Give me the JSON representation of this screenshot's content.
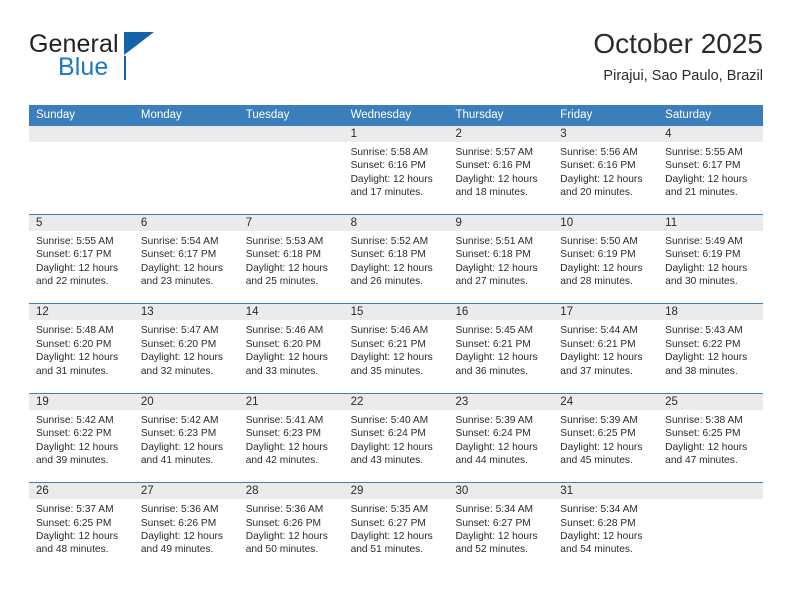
{
  "brand": {
    "name_part1": "General",
    "name_part2": "Blue",
    "logo_icon": "triangle-logo-icon",
    "accent_color": "#1463a8"
  },
  "header": {
    "title": "October 2025",
    "location": "Pirajui, Sao Paulo, Brazil"
  },
  "theme": {
    "header_blue": "#3b7ebc",
    "day_band_gray": "#ebebeb",
    "text": "#2b2b2b"
  },
  "calendar": {
    "weekdays": [
      "Sunday",
      "Monday",
      "Tuesday",
      "Wednesday",
      "Thursday",
      "Friday",
      "Saturday"
    ],
    "labels": {
      "sunrise_prefix": "Sunrise:",
      "sunset_prefix": "Sunset:",
      "daylight_prefix": "Daylight:"
    },
    "weeks": [
      [
        {
          "day": "",
          "empty": true
        },
        {
          "day": "",
          "empty": true
        },
        {
          "day": "",
          "empty": true
        },
        {
          "day": "1",
          "sunrise": "Sunrise: 5:58 AM",
          "sunset": "Sunset: 6:16 PM",
          "daylight_line1": "Daylight: 12 hours",
          "daylight_line2": "and 17 minutes."
        },
        {
          "day": "2",
          "sunrise": "Sunrise: 5:57 AM",
          "sunset": "Sunset: 6:16 PM",
          "daylight_line1": "Daylight: 12 hours",
          "daylight_line2": "and 18 minutes."
        },
        {
          "day": "3",
          "sunrise": "Sunrise: 5:56 AM",
          "sunset": "Sunset: 6:16 PM",
          "daylight_line1": "Daylight: 12 hours",
          "daylight_line2": "and 20 minutes."
        },
        {
          "day": "4",
          "sunrise": "Sunrise: 5:55 AM",
          "sunset": "Sunset: 6:17 PM",
          "daylight_line1": "Daylight: 12 hours",
          "daylight_line2": "and 21 minutes."
        }
      ],
      [
        {
          "day": "5",
          "sunrise": "Sunrise: 5:55 AM",
          "sunset": "Sunset: 6:17 PM",
          "daylight_line1": "Daylight: 12 hours",
          "daylight_line2": "and 22 minutes."
        },
        {
          "day": "6",
          "sunrise": "Sunrise: 5:54 AM",
          "sunset": "Sunset: 6:17 PM",
          "daylight_line1": "Daylight: 12 hours",
          "daylight_line2": "and 23 minutes."
        },
        {
          "day": "7",
          "sunrise": "Sunrise: 5:53 AM",
          "sunset": "Sunset: 6:18 PM",
          "daylight_line1": "Daylight: 12 hours",
          "daylight_line2": "and 25 minutes."
        },
        {
          "day": "8",
          "sunrise": "Sunrise: 5:52 AM",
          "sunset": "Sunset: 6:18 PM",
          "daylight_line1": "Daylight: 12 hours",
          "daylight_line2": "and 26 minutes."
        },
        {
          "day": "9",
          "sunrise": "Sunrise: 5:51 AM",
          "sunset": "Sunset: 6:18 PM",
          "daylight_line1": "Daylight: 12 hours",
          "daylight_line2": "and 27 minutes."
        },
        {
          "day": "10",
          "sunrise": "Sunrise: 5:50 AM",
          "sunset": "Sunset: 6:19 PM",
          "daylight_line1": "Daylight: 12 hours",
          "daylight_line2": "and 28 minutes."
        },
        {
          "day": "11",
          "sunrise": "Sunrise: 5:49 AM",
          "sunset": "Sunset: 6:19 PM",
          "daylight_line1": "Daylight: 12 hours",
          "daylight_line2": "and 30 minutes."
        }
      ],
      [
        {
          "day": "12",
          "sunrise": "Sunrise: 5:48 AM",
          "sunset": "Sunset: 6:20 PM",
          "daylight_line1": "Daylight: 12 hours",
          "daylight_line2": "and 31 minutes."
        },
        {
          "day": "13",
          "sunrise": "Sunrise: 5:47 AM",
          "sunset": "Sunset: 6:20 PM",
          "daylight_line1": "Daylight: 12 hours",
          "daylight_line2": "and 32 minutes."
        },
        {
          "day": "14",
          "sunrise": "Sunrise: 5:46 AM",
          "sunset": "Sunset: 6:20 PM",
          "daylight_line1": "Daylight: 12 hours",
          "daylight_line2": "and 33 minutes."
        },
        {
          "day": "15",
          "sunrise": "Sunrise: 5:46 AM",
          "sunset": "Sunset: 6:21 PM",
          "daylight_line1": "Daylight: 12 hours",
          "daylight_line2": "and 35 minutes."
        },
        {
          "day": "16",
          "sunrise": "Sunrise: 5:45 AM",
          "sunset": "Sunset: 6:21 PM",
          "daylight_line1": "Daylight: 12 hours",
          "daylight_line2": "and 36 minutes."
        },
        {
          "day": "17",
          "sunrise": "Sunrise: 5:44 AM",
          "sunset": "Sunset: 6:21 PM",
          "daylight_line1": "Daylight: 12 hours",
          "daylight_line2": "and 37 minutes."
        },
        {
          "day": "18",
          "sunrise": "Sunrise: 5:43 AM",
          "sunset": "Sunset: 6:22 PM",
          "daylight_line1": "Daylight: 12 hours",
          "daylight_line2": "and 38 minutes."
        }
      ],
      [
        {
          "day": "19",
          "sunrise": "Sunrise: 5:42 AM",
          "sunset": "Sunset: 6:22 PM",
          "daylight_line1": "Daylight: 12 hours",
          "daylight_line2": "and 39 minutes."
        },
        {
          "day": "20",
          "sunrise": "Sunrise: 5:42 AM",
          "sunset": "Sunset: 6:23 PM",
          "daylight_line1": "Daylight: 12 hours",
          "daylight_line2": "and 41 minutes."
        },
        {
          "day": "21",
          "sunrise": "Sunrise: 5:41 AM",
          "sunset": "Sunset: 6:23 PM",
          "daylight_line1": "Daylight: 12 hours",
          "daylight_line2": "and 42 minutes."
        },
        {
          "day": "22",
          "sunrise": "Sunrise: 5:40 AM",
          "sunset": "Sunset: 6:24 PM",
          "daylight_line1": "Daylight: 12 hours",
          "daylight_line2": "and 43 minutes."
        },
        {
          "day": "23",
          "sunrise": "Sunrise: 5:39 AM",
          "sunset": "Sunset: 6:24 PM",
          "daylight_line1": "Daylight: 12 hours",
          "daylight_line2": "and 44 minutes."
        },
        {
          "day": "24",
          "sunrise": "Sunrise: 5:39 AM",
          "sunset": "Sunset: 6:25 PM",
          "daylight_line1": "Daylight: 12 hours",
          "daylight_line2": "and 45 minutes."
        },
        {
          "day": "25",
          "sunrise": "Sunrise: 5:38 AM",
          "sunset": "Sunset: 6:25 PM",
          "daylight_line1": "Daylight: 12 hours",
          "daylight_line2": "and 47 minutes."
        }
      ],
      [
        {
          "day": "26",
          "sunrise": "Sunrise: 5:37 AM",
          "sunset": "Sunset: 6:25 PM",
          "daylight_line1": "Daylight: 12 hours",
          "daylight_line2": "and 48 minutes."
        },
        {
          "day": "27",
          "sunrise": "Sunrise: 5:36 AM",
          "sunset": "Sunset: 6:26 PM",
          "daylight_line1": "Daylight: 12 hours",
          "daylight_line2": "and 49 minutes."
        },
        {
          "day": "28",
          "sunrise": "Sunrise: 5:36 AM",
          "sunset": "Sunset: 6:26 PM",
          "daylight_line1": "Daylight: 12 hours",
          "daylight_line2": "and 50 minutes."
        },
        {
          "day": "29",
          "sunrise": "Sunrise: 5:35 AM",
          "sunset": "Sunset: 6:27 PM",
          "daylight_line1": "Daylight: 12 hours",
          "daylight_line2": "and 51 minutes."
        },
        {
          "day": "30",
          "sunrise": "Sunrise: 5:34 AM",
          "sunset": "Sunset: 6:27 PM",
          "daylight_line1": "Daylight: 12 hours",
          "daylight_line2": "and 52 minutes."
        },
        {
          "day": "31",
          "sunrise": "Sunrise: 5:34 AM",
          "sunset": "Sunset: 6:28 PM",
          "daylight_line1": "Daylight: 12 hours",
          "daylight_line2": "and 54 minutes."
        },
        {
          "day": "",
          "empty": true
        }
      ]
    ]
  }
}
